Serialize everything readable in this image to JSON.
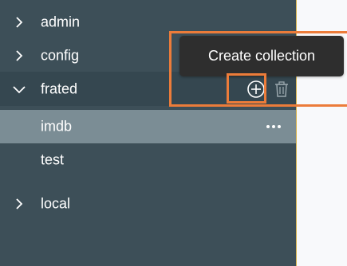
{
  "sidebar": {
    "databases": [
      {
        "label": "admin",
        "expanded": false
      },
      {
        "label": "config",
        "expanded": false
      },
      {
        "label": "frated",
        "expanded": true,
        "collections": [
          {
            "label": "imdb",
            "selected": true
          },
          {
            "label": "test",
            "selected": false
          }
        ]
      },
      {
        "label": "local",
        "expanded": false
      }
    ]
  },
  "tooltip": {
    "text": "Create collection"
  },
  "icons": {
    "collapsed": "chevron-right-icon",
    "expanded": "chevron-down-icon",
    "add": "plus-circle-icon",
    "delete": "trash-icon",
    "more": "ellipsis-icon"
  },
  "colors": {
    "sidebar_bg": "#3d4f58",
    "selected_bg": "#7b8d95",
    "highlight": "#ec7c3a",
    "tooltip_bg": "#2e2e2e"
  }
}
